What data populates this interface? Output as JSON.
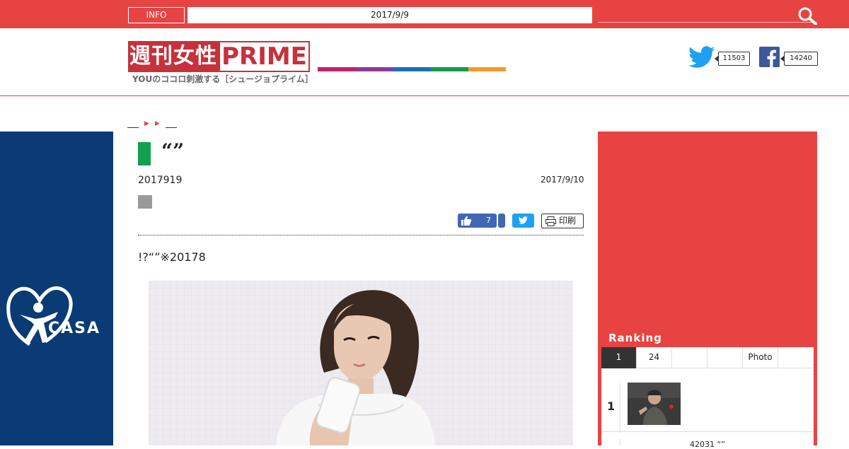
{
  "topbar": {
    "info_label": "INFO",
    "date_text": "2017/9/9",
    "search_icon": "search-icon"
  },
  "header": {
    "logo_left": "週刊女性",
    "logo_right": "PRIME",
    "tagline": "YOUのココロ刺激する［シュージョプライム］",
    "twitter_count": "11503",
    "facebook_count": "14240",
    "colorbar": [
      "#c6206b",
      "#8e3a98",
      "#1d6fb5",
      "#149a46",
      "#f39a2b"
    ]
  },
  "side_ad": {
    "brand": "CASA",
    "bg_color": "#0b3b75"
  },
  "article": {
    "title": "“”",
    "published": "2017919",
    "updated": "2017/9/10",
    "like_count": "7",
    "print_label": "印刷",
    "lead": "!?“”※20178",
    "title_mark_color": "#11a050"
  },
  "ranking": {
    "header": "Ranking",
    "tabs": [
      "1",
      "24",
      "",
      "",
      "Photo",
      ""
    ],
    "row1_num": "1",
    "row2_text": "42031 “”"
  }
}
